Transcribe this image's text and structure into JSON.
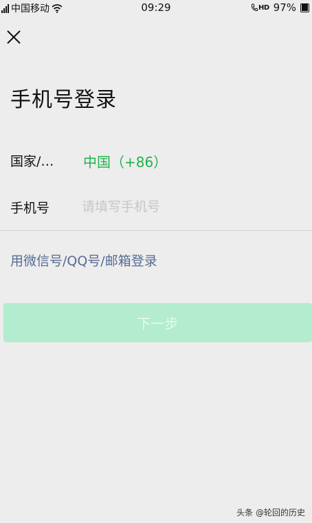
{
  "status_bar": {
    "carrier": "中国移动",
    "time": "09:29",
    "hd_label": "HD",
    "battery": "97%"
  },
  "page": {
    "title": "手机号登录"
  },
  "form": {
    "country_label": "国家/…",
    "country_value": "中国（+86）",
    "phone_label": "手机号",
    "phone_value": "",
    "phone_placeholder": "请填写手机号"
  },
  "alt_login_link": "用微信号/QQ号/邮箱登录",
  "next_button": "下一步",
  "watermark": "头条 @轮回的历史",
  "colors": {
    "background": "#ededed",
    "country_value": "#22b14c",
    "link": "#576b95",
    "next_button_disabled": "#b3ecce"
  }
}
